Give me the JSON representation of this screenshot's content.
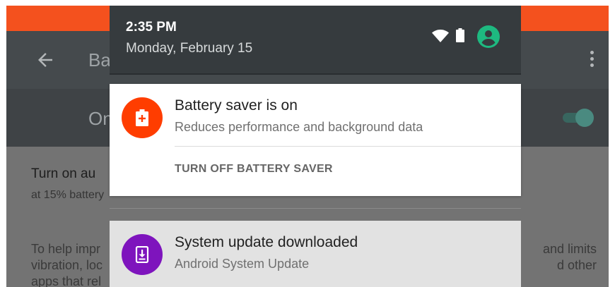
{
  "status_bar": {
    "time": "2:35 PM",
    "date": "Monday, February 15"
  },
  "app_bar": {
    "title_visible": "Ba"
  },
  "master_switch": {
    "label_visible": "On",
    "state": "on"
  },
  "settings": {
    "auto_title_visible": "Turn on au",
    "auto_sub_visible": "at 15% battery",
    "desc_line1_left": "To help impr",
    "desc_line1_right": "and limits",
    "desc_line2_left": "vibration, loc",
    "desc_line2_right": "d other",
    "desc_line3_left": "apps that rel"
  },
  "notifications": [
    {
      "title": "Battery saver is on",
      "subtitle": "Reduces performance and background data",
      "action": "TURN OFF BATTERY SAVER",
      "icon": "battery-saver-icon",
      "color": "#ff3d00"
    },
    {
      "title": "System update downloaded",
      "subtitle": "Android System Update",
      "icon": "system-update-icon",
      "color": "#7e14bd"
    }
  ],
  "colors": {
    "status_strip": "#f4511e",
    "accent": "#4db6ac",
    "account": "#1eb980"
  }
}
